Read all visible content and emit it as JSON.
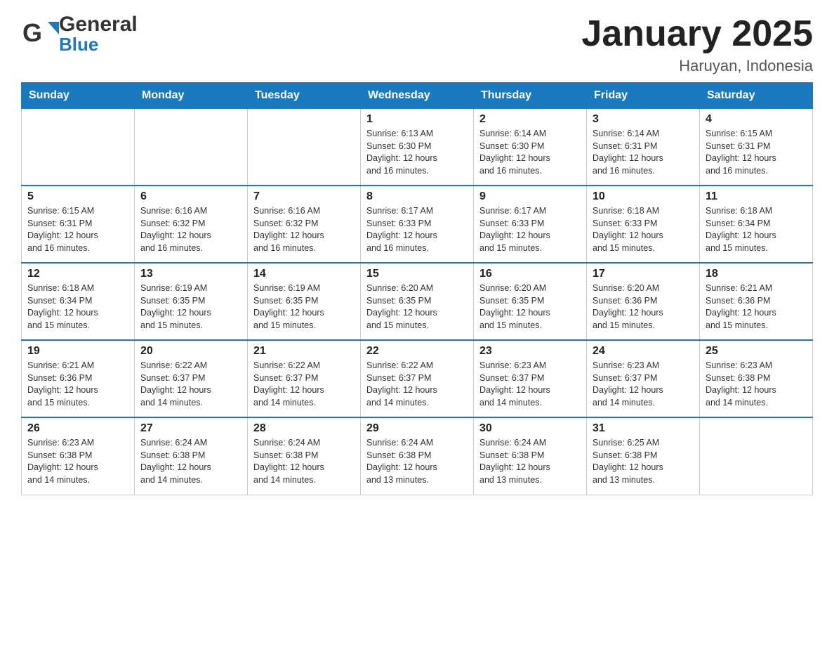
{
  "header": {
    "logo_general": "General",
    "logo_blue": "Blue",
    "month_title": "January 2025",
    "location": "Haruyan, Indonesia"
  },
  "days_of_week": [
    "Sunday",
    "Monday",
    "Tuesday",
    "Wednesday",
    "Thursday",
    "Friday",
    "Saturday"
  ],
  "weeks": [
    [
      {
        "day": "",
        "info": ""
      },
      {
        "day": "",
        "info": ""
      },
      {
        "day": "",
        "info": ""
      },
      {
        "day": "1",
        "info": "Sunrise: 6:13 AM\nSunset: 6:30 PM\nDaylight: 12 hours\nand 16 minutes."
      },
      {
        "day": "2",
        "info": "Sunrise: 6:14 AM\nSunset: 6:30 PM\nDaylight: 12 hours\nand 16 minutes."
      },
      {
        "day": "3",
        "info": "Sunrise: 6:14 AM\nSunset: 6:31 PM\nDaylight: 12 hours\nand 16 minutes."
      },
      {
        "day": "4",
        "info": "Sunrise: 6:15 AM\nSunset: 6:31 PM\nDaylight: 12 hours\nand 16 minutes."
      }
    ],
    [
      {
        "day": "5",
        "info": "Sunrise: 6:15 AM\nSunset: 6:31 PM\nDaylight: 12 hours\nand 16 minutes."
      },
      {
        "day": "6",
        "info": "Sunrise: 6:16 AM\nSunset: 6:32 PM\nDaylight: 12 hours\nand 16 minutes."
      },
      {
        "day": "7",
        "info": "Sunrise: 6:16 AM\nSunset: 6:32 PM\nDaylight: 12 hours\nand 16 minutes."
      },
      {
        "day": "8",
        "info": "Sunrise: 6:17 AM\nSunset: 6:33 PM\nDaylight: 12 hours\nand 16 minutes."
      },
      {
        "day": "9",
        "info": "Sunrise: 6:17 AM\nSunset: 6:33 PM\nDaylight: 12 hours\nand 15 minutes."
      },
      {
        "day": "10",
        "info": "Sunrise: 6:18 AM\nSunset: 6:33 PM\nDaylight: 12 hours\nand 15 minutes."
      },
      {
        "day": "11",
        "info": "Sunrise: 6:18 AM\nSunset: 6:34 PM\nDaylight: 12 hours\nand 15 minutes."
      }
    ],
    [
      {
        "day": "12",
        "info": "Sunrise: 6:18 AM\nSunset: 6:34 PM\nDaylight: 12 hours\nand 15 minutes."
      },
      {
        "day": "13",
        "info": "Sunrise: 6:19 AM\nSunset: 6:35 PM\nDaylight: 12 hours\nand 15 minutes."
      },
      {
        "day": "14",
        "info": "Sunrise: 6:19 AM\nSunset: 6:35 PM\nDaylight: 12 hours\nand 15 minutes."
      },
      {
        "day": "15",
        "info": "Sunrise: 6:20 AM\nSunset: 6:35 PM\nDaylight: 12 hours\nand 15 minutes."
      },
      {
        "day": "16",
        "info": "Sunrise: 6:20 AM\nSunset: 6:35 PM\nDaylight: 12 hours\nand 15 minutes."
      },
      {
        "day": "17",
        "info": "Sunrise: 6:20 AM\nSunset: 6:36 PM\nDaylight: 12 hours\nand 15 minutes."
      },
      {
        "day": "18",
        "info": "Sunrise: 6:21 AM\nSunset: 6:36 PM\nDaylight: 12 hours\nand 15 minutes."
      }
    ],
    [
      {
        "day": "19",
        "info": "Sunrise: 6:21 AM\nSunset: 6:36 PM\nDaylight: 12 hours\nand 15 minutes."
      },
      {
        "day": "20",
        "info": "Sunrise: 6:22 AM\nSunset: 6:37 PM\nDaylight: 12 hours\nand 14 minutes."
      },
      {
        "day": "21",
        "info": "Sunrise: 6:22 AM\nSunset: 6:37 PM\nDaylight: 12 hours\nand 14 minutes."
      },
      {
        "day": "22",
        "info": "Sunrise: 6:22 AM\nSunset: 6:37 PM\nDaylight: 12 hours\nand 14 minutes."
      },
      {
        "day": "23",
        "info": "Sunrise: 6:23 AM\nSunset: 6:37 PM\nDaylight: 12 hours\nand 14 minutes."
      },
      {
        "day": "24",
        "info": "Sunrise: 6:23 AM\nSunset: 6:37 PM\nDaylight: 12 hours\nand 14 minutes."
      },
      {
        "day": "25",
        "info": "Sunrise: 6:23 AM\nSunset: 6:38 PM\nDaylight: 12 hours\nand 14 minutes."
      }
    ],
    [
      {
        "day": "26",
        "info": "Sunrise: 6:23 AM\nSunset: 6:38 PM\nDaylight: 12 hours\nand 14 minutes."
      },
      {
        "day": "27",
        "info": "Sunrise: 6:24 AM\nSunset: 6:38 PM\nDaylight: 12 hours\nand 14 minutes."
      },
      {
        "day": "28",
        "info": "Sunrise: 6:24 AM\nSunset: 6:38 PM\nDaylight: 12 hours\nand 14 minutes."
      },
      {
        "day": "29",
        "info": "Sunrise: 6:24 AM\nSunset: 6:38 PM\nDaylight: 12 hours\nand 13 minutes."
      },
      {
        "day": "30",
        "info": "Sunrise: 6:24 AM\nSunset: 6:38 PM\nDaylight: 12 hours\nand 13 minutes."
      },
      {
        "day": "31",
        "info": "Sunrise: 6:25 AM\nSunset: 6:38 PM\nDaylight: 12 hours\nand 13 minutes."
      },
      {
        "day": "",
        "info": ""
      }
    ]
  ]
}
